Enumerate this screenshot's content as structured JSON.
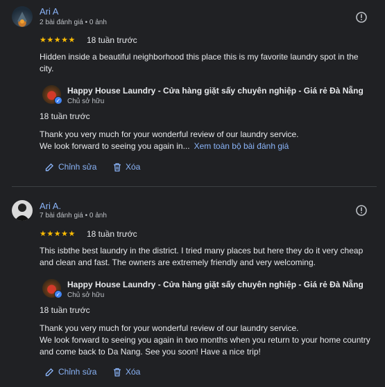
{
  "reviews": [
    {
      "name": "Ari A",
      "meta": "2 bài đánh giá • 0 ảnh",
      "stars": "★★★★★",
      "time": "18 tuần trước",
      "text": "Hidden inside a beautiful neighborhood this place this is my favorite laundry spot in the city.",
      "reply": {
        "owner_name": "Happy House Laundry - Cửa hàng giặt sấy chuyên nghiệp - Giá rẻ Đà Nẵng",
        "owner_role": "Chủ sở hữu",
        "time": "18 tuần trước",
        "text": "Thank you very much for your wonderful review of our laundry service.\nWe look forward to seeing you again in...",
        "more_link": "Xem toàn bộ bài đánh giá"
      },
      "edit_label": "Chỉnh sửa",
      "delete_label": "Xóa"
    },
    {
      "name": "Ari A.",
      "meta": "7 bài đánh giá • 0 ảnh",
      "stars": "★★★★★",
      "time": "18 tuần trước",
      "text": "This isbthe best laundry in the district. I tried many places but here they do it very cheap and clean and fast. The owners are extremely friendly and very welcoming.",
      "reply": {
        "owner_name": "Happy House Laundry - Cửa hàng giặt sấy chuyên nghiệp - Giá rẻ Đà Nẵng",
        "owner_role": "Chủ sở hữu",
        "time": "18 tuần trước",
        "text": "Thank you very much for your wonderful review of our laundry service.\nWe look forward to seeing you again in two months when you return to your home country and come back to Da Nang. See you soon! Have a nice trip!"
      },
      "edit_label": "Chỉnh sửa",
      "delete_label": "Xóa"
    }
  ]
}
